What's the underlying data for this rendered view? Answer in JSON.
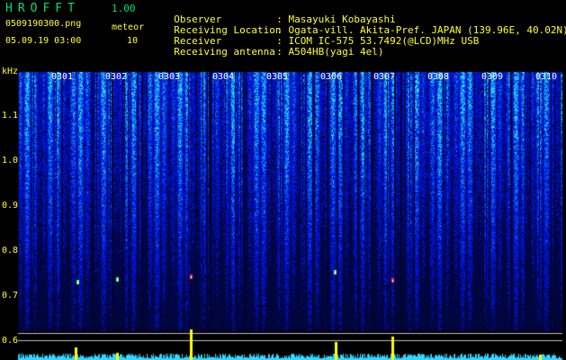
{
  "header": {
    "app_title": "HROFFT",
    "version": "1.00",
    "filename": "0509190300.png",
    "meteor_label": "meteor",
    "datetime": "05.09.19 03:00",
    "meteor_count": "10"
  },
  "station_info": [
    {
      "key": "Observer",
      "value": ": Masayuki Kobayashi"
    },
    {
      "key": "Receiving Location",
      "value": ": Ogata-vill. Akita-Pref. JAPAN (139.96E, 40.02N)"
    },
    {
      "key": "Receiver",
      "value": ": ICOM IC-575 53.7492(@LCD)MHz USB"
    },
    {
      "key": "Receiving antenna",
      "value": ": A504HB(yagi 4el)"
    }
  ],
  "axis": {
    "unit": "kHz",
    "freq_ticks": [
      "1.1",
      "1.0",
      "0.9",
      "0.8",
      "0.7",
      "0.6"
    ],
    "time_ticks": [
      "0301",
      "0302",
      "0303",
      "0304",
      "0305",
      "0306",
      "0307",
      "0308",
      "0309",
      "0310"
    ]
  },
  "colors": {
    "background": "#000000",
    "spectrogram_low": "#001070",
    "spectrogram_high": "#20c0ff",
    "meteor_echo": "#ff4040",
    "level_bar": "#ffff00",
    "baseline_noise": "#40e0ff"
  }
}
